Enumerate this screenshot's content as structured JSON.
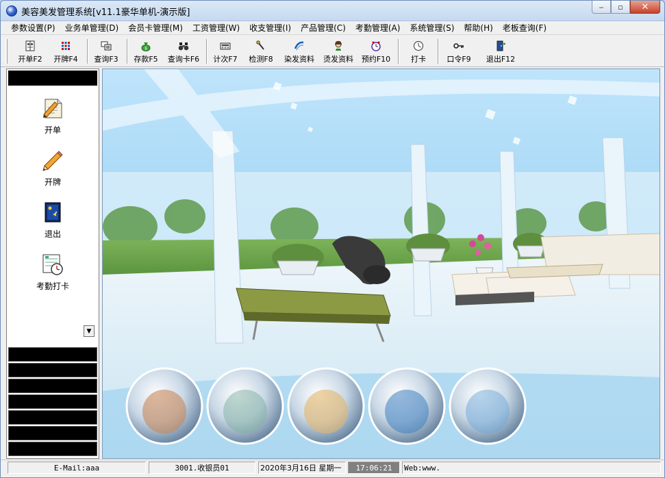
{
  "window": {
    "title": "美容美发管理系统[v11.1豪华单机-演示版]",
    "controls": {
      "minimize": "‒",
      "maximize": "▫",
      "close": "✕"
    }
  },
  "menu": [
    "参数设置(P)",
    "业务单管理(D)",
    "会员卡管理(M)",
    "工资管理(W)",
    "收支管理(I)",
    "产品管理(C)",
    "考勤管理(A)",
    "系统管理(S)",
    "帮助(H)",
    "老板查询(F)"
  ],
  "toolbar": [
    {
      "label": "开单F2",
      "icon": "bill-icon"
    },
    {
      "label": "开牌F4",
      "icon": "card-grid-icon"
    },
    {
      "label": "查询F3",
      "icon": "query-icon"
    },
    {
      "label": "存款F5",
      "icon": "money-bag-icon"
    },
    {
      "label": "查询卡F6",
      "icon": "binoculars-icon"
    },
    {
      "label": "计次F7",
      "icon": "counter-icon"
    },
    {
      "label": "检测F8",
      "icon": "detect-icon"
    },
    {
      "label": "染发资料",
      "icon": "hair-dye-icon"
    },
    {
      "label": "烫发资料",
      "icon": "perm-icon"
    },
    {
      "label": "预约F10",
      "icon": "appointment-icon"
    },
    {
      "label": "打卡",
      "icon": "clock-icon"
    },
    {
      "label": "口令F9",
      "icon": "key-icon"
    },
    {
      "label": "退出F12",
      "icon": "exit-door-icon"
    }
  ],
  "sidebar": {
    "items": [
      {
        "label": "开单",
        "icon": "pencil-paper-icon"
      },
      {
        "label": "开牌",
        "icon": "pencil-icon"
      },
      {
        "label": "退出",
        "icon": "exit-door-icon"
      },
      {
        "label": "考勤打卡",
        "icon": "attendance-clock-icon"
      }
    ]
  },
  "status": {
    "email": "E-Mail:aaa",
    "operator": "3001.收银员01",
    "date": "2020年3月16日  星期一",
    "time": "17:06:21",
    "web": "Web:www."
  },
  "colors": {
    "accent": "#3b6fd6",
    "close_button": "#c7412b",
    "clock_bg": "#808080"
  }
}
